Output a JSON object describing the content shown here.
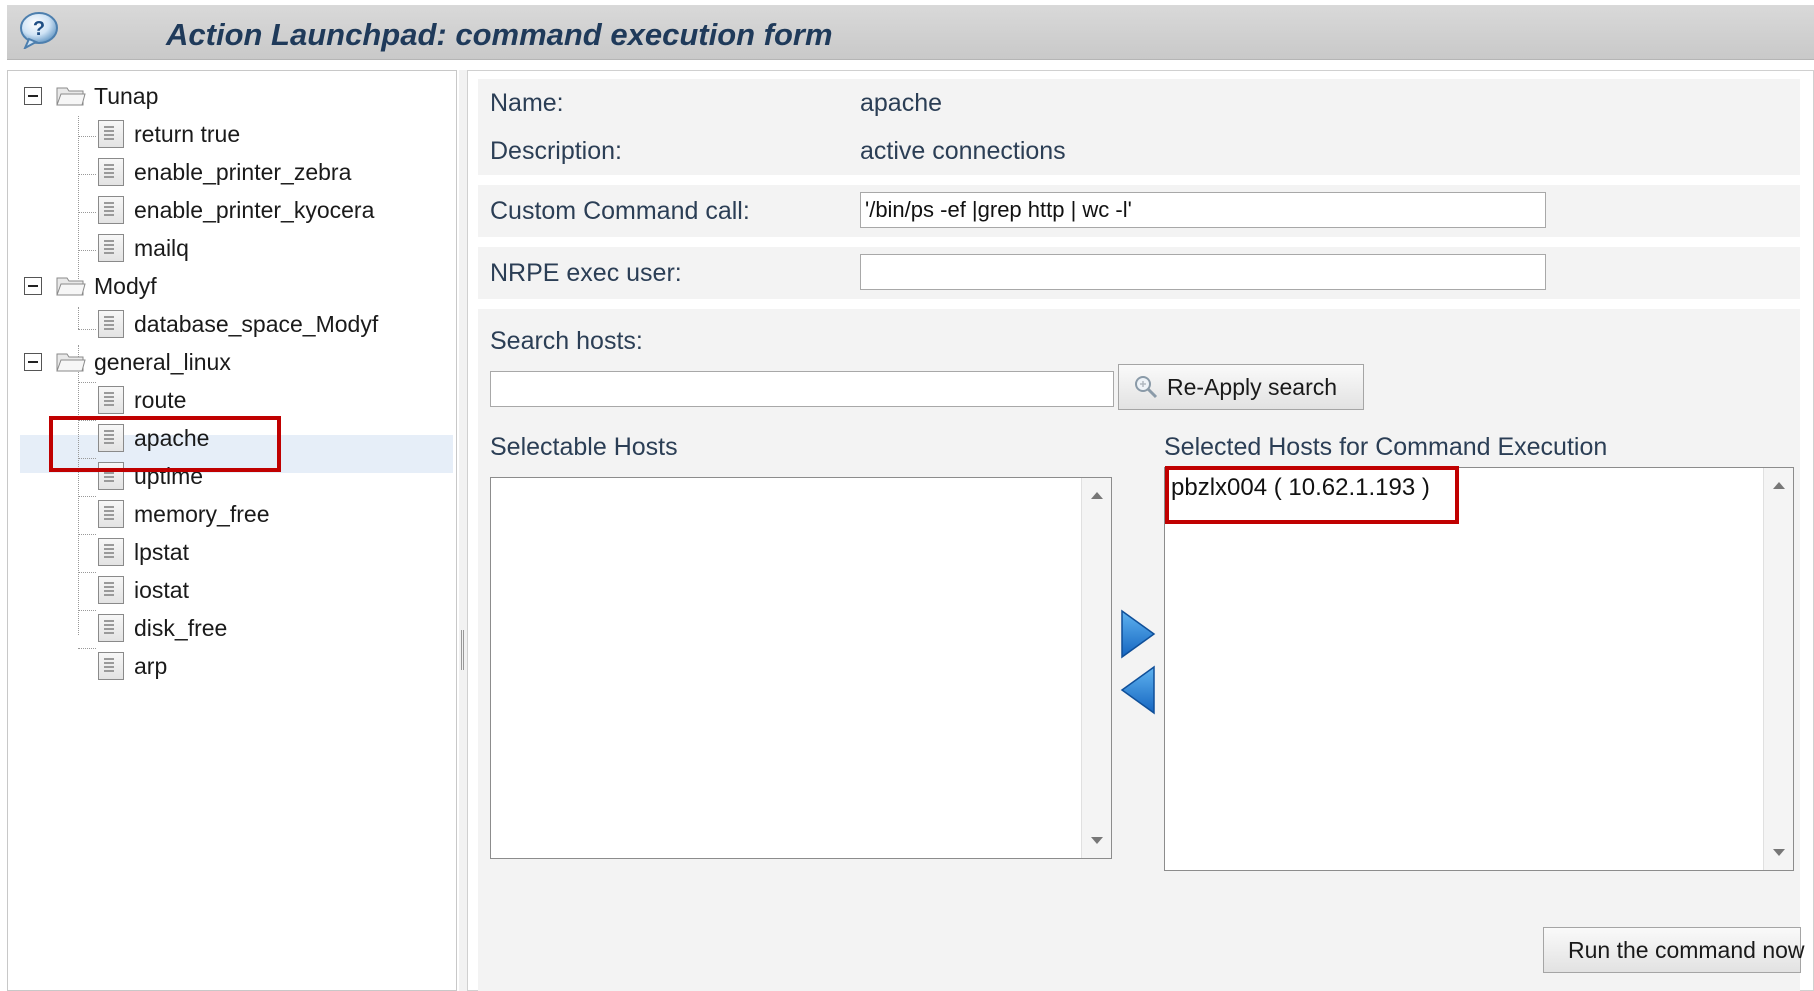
{
  "header": {
    "title": "Action Launchpad: command execution form",
    "help_icon": "help-icon"
  },
  "tree": {
    "groups": [
      {
        "label": "Tunap",
        "items": [
          "return true",
          "enable_printer_zebra",
          "enable_printer_kyocera",
          "mailq"
        ]
      },
      {
        "label": "Modyf",
        "items": [
          "database_space_Modyf"
        ]
      },
      {
        "label": "general_linux",
        "items": [
          "route",
          "apache",
          "uptime",
          "memory_free",
          "lpstat",
          "iostat",
          "disk_free",
          "arp"
        ]
      }
    ],
    "selected_item": "apache"
  },
  "form": {
    "name_label": "Name:",
    "name_value": "apache",
    "description_label": "Description:",
    "description_value": "active connections",
    "custom_command_label": "Custom Command call:",
    "custom_command_value": "'/bin/ps -ef |grep http | wc -l'",
    "nrpe_user_label": "NRPE exec user:",
    "nrpe_user_value": "",
    "search_hosts_label": "Search hosts:",
    "search_hosts_value": "",
    "reapply_button": "Re-Apply search",
    "selectable_hosts_title": "Selectable Hosts",
    "selectable_hosts": [],
    "selected_hosts_title": "Selected Hosts for Command Execution",
    "selected_hosts": [
      "pbzlx004 ( 10.62.1.193 )"
    ],
    "run_button": "Run the command now"
  },
  "colors": {
    "header_title": "#1f3a5a",
    "highlight": "#c00000",
    "arrow_blue": "#1f7fd6",
    "run_check": "#2aa53a"
  }
}
